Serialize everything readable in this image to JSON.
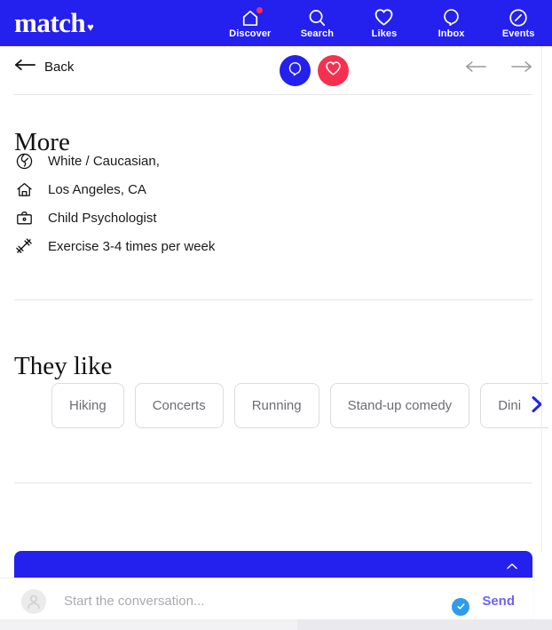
{
  "brand": {
    "name": "match",
    "heart_icon": "heart-icon"
  },
  "colors": {
    "brand_blue": "#2420ed",
    "like_red": "#f5314f",
    "notification_dot": "#ff2b55",
    "send_purple": "#6c63f5",
    "check_blue": "#2e9bf0",
    "chip_border": "#dcdcdc",
    "divider": "#e6e6e6"
  },
  "topnav": {
    "items": [
      {
        "label": "Discover",
        "icon": "home-icon",
        "badge": true
      },
      {
        "label": "Search",
        "icon": "search-icon",
        "badge": false
      },
      {
        "label": "Likes",
        "icon": "heart-icon",
        "badge": false
      },
      {
        "label": "Inbox",
        "icon": "chat-bubble-icon",
        "badge": false
      },
      {
        "label": "Events",
        "icon": "ticket-tag-icon",
        "badge": false
      }
    ]
  },
  "subheader": {
    "back_label": "Back",
    "back_icon": "arrow-left-icon",
    "chat_action_icon": "chat-bubble-icon",
    "like_action_icon": "heart-icon",
    "prev_icon": "arrow-left-icon",
    "next_icon": "arrow-right-icon"
  },
  "more": {
    "title": "More",
    "facts": [
      {
        "icon": "globe-icon",
        "text": "White / Caucasian,"
      },
      {
        "icon": "home-icon",
        "text": "Los Angeles, CA"
      },
      {
        "icon": "briefcase-icon",
        "text": "Child Psychologist"
      },
      {
        "icon": "dumbbell-icon",
        "text": "Exercise 3-4 times per week"
      }
    ]
  },
  "they_like": {
    "title": "They like",
    "chips": [
      "Hiking",
      "Concerts",
      "Running",
      "Stand-up comedy",
      "Dining out"
    ],
    "next_icon": "chevron-right-icon"
  },
  "chat_dock": {
    "collapse_icon": "chevron-up-icon",
    "avatar_icon": "user-avatar-icon",
    "placeholder": "Start the conversation...",
    "input_value": "",
    "verified_icon": "check-circle-icon",
    "send_label": "Send"
  }
}
